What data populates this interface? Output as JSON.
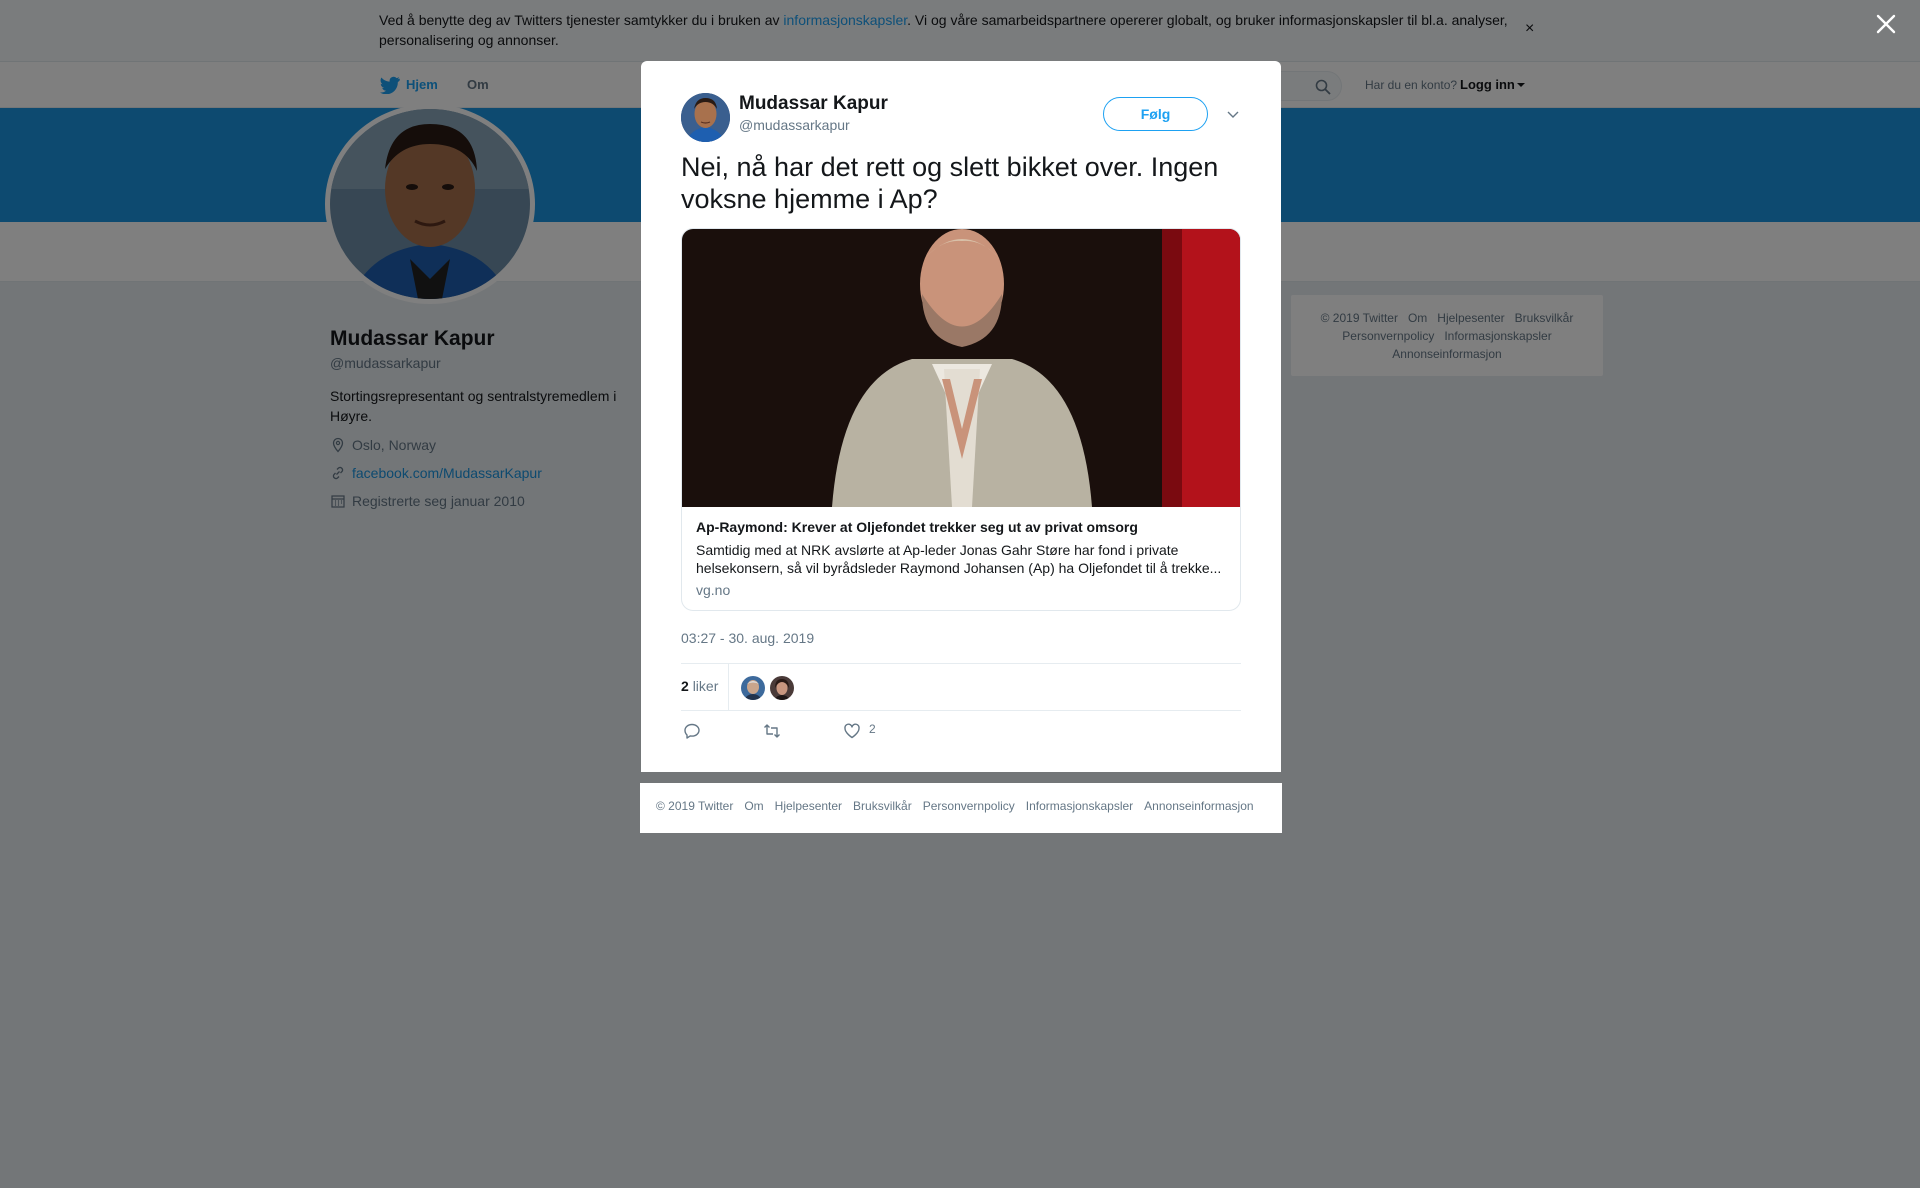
{
  "cookie_banner": {
    "text_before": "Ved å benytte deg av Twitters tjenester samtykker du i bruken av ",
    "link": "informasjonskapsler",
    "text_after": ". Vi og våre samarbeidspartnere opererer globalt, og bruker informasjonskapsler til bl.a. analyser, personalisering og annonser.",
    "close": "×"
  },
  "nav": {
    "home": "Hjem",
    "about": "Om",
    "login_question": "Har du en konto?",
    "login_link": "Logg inn"
  },
  "profile": {
    "name": "Mudassar Kapur",
    "handle": "@mudassarkapur",
    "bio": "Stortingsrepresentant og sentralstyremedlem i Høyre.",
    "location": "Oslo, Norway",
    "website": "facebook.com/MudassarKapur",
    "joined": "Registrerte seg januar 2010"
  },
  "side_footer": {
    "items": [
      "© 2019 Twitter",
      "Om",
      "Hjelpesenter",
      "Bruksvilkår",
      "Personvernpolicy",
      "Informasjonskapsler",
      "Annonseinformasjon"
    ]
  },
  "tweet": {
    "author_name": "Mudassar Kapur",
    "author_handle": "@mudassarkapur",
    "follow_label": "Følg",
    "text": "Nei, nå har det rett og slett bikket over. Ingen voksne hjemme i Ap?",
    "card": {
      "title": "Ap-Raymond: Krever at Oljefondet trekker seg ut av privat omsorg",
      "description": "Samtidig med at NRK avslørte at Ap-leder Jonas Gahr Støre har fond i private helsekonsern, så vil byrådsleder Raymond Johansen (Ap) ha Oljefondet til å trekke...",
      "domain": "vg.no"
    },
    "timestamp": "03:27 - 30. aug. 2019",
    "likes_count": "2",
    "likes_label": "liker",
    "like_action_count": "2"
  },
  "modal_footer": {
    "items": [
      "© 2019 Twitter",
      "Om",
      "Hjelpesenter",
      "Bruksvilkår",
      "Personvernpolicy",
      "Informasjonskapsler",
      "Annonseinformasjon"
    ]
  },
  "colors": {
    "accent": "#1da1f2",
    "banner": "#1b95e0",
    "overlay": "rgba(0,0,0,0.5)"
  },
  "icons": [
    "twitter-bird-icon",
    "search-icon",
    "location-icon",
    "link-icon",
    "calendar-icon",
    "close-icon",
    "chevron-down-icon",
    "reply-icon",
    "retweet-icon",
    "heart-icon"
  ]
}
